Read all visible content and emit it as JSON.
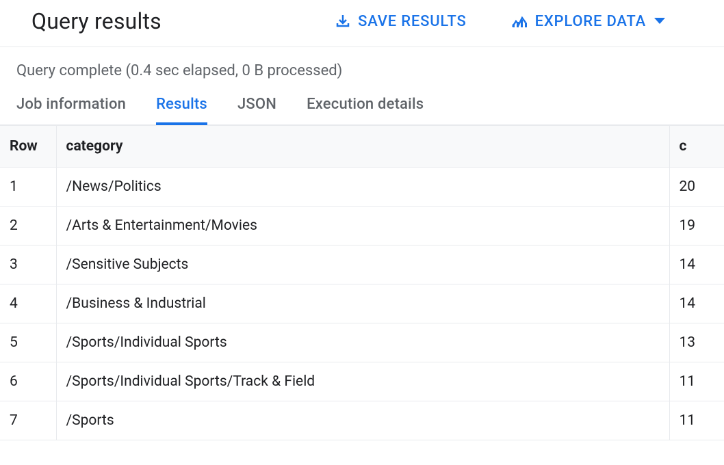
{
  "header": {
    "title": "Query results",
    "save_label": "SAVE RESULTS",
    "explore_label": "EXPLORE DATA"
  },
  "status": "Query complete (0.4 sec elapsed, 0 B processed)",
  "tabs": [
    {
      "label": "Job information",
      "active": false
    },
    {
      "label": "Results",
      "active": true
    },
    {
      "label": "JSON",
      "active": false
    },
    {
      "label": "Execution details",
      "active": false
    }
  ],
  "table": {
    "columns": [
      "Row",
      "category",
      "c"
    ],
    "rows": [
      {
        "row": 1,
        "category": "/News/Politics",
        "c": 20
      },
      {
        "row": 2,
        "category": "/Arts & Entertainment/Movies",
        "c": 19
      },
      {
        "row": 3,
        "category": "/Sensitive Subjects",
        "c": 14
      },
      {
        "row": 4,
        "category": "/Business & Industrial",
        "c": 14
      },
      {
        "row": 5,
        "category": "/Sports/Individual Sports",
        "c": 13
      },
      {
        "row": 6,
        "category": "/Sports/Individual Sports/Track & Field",
        "c": 11
      },
      {
        "row": 7,
        "category": "/Sports",
        "c": 11
      }
    ]
  }
}
